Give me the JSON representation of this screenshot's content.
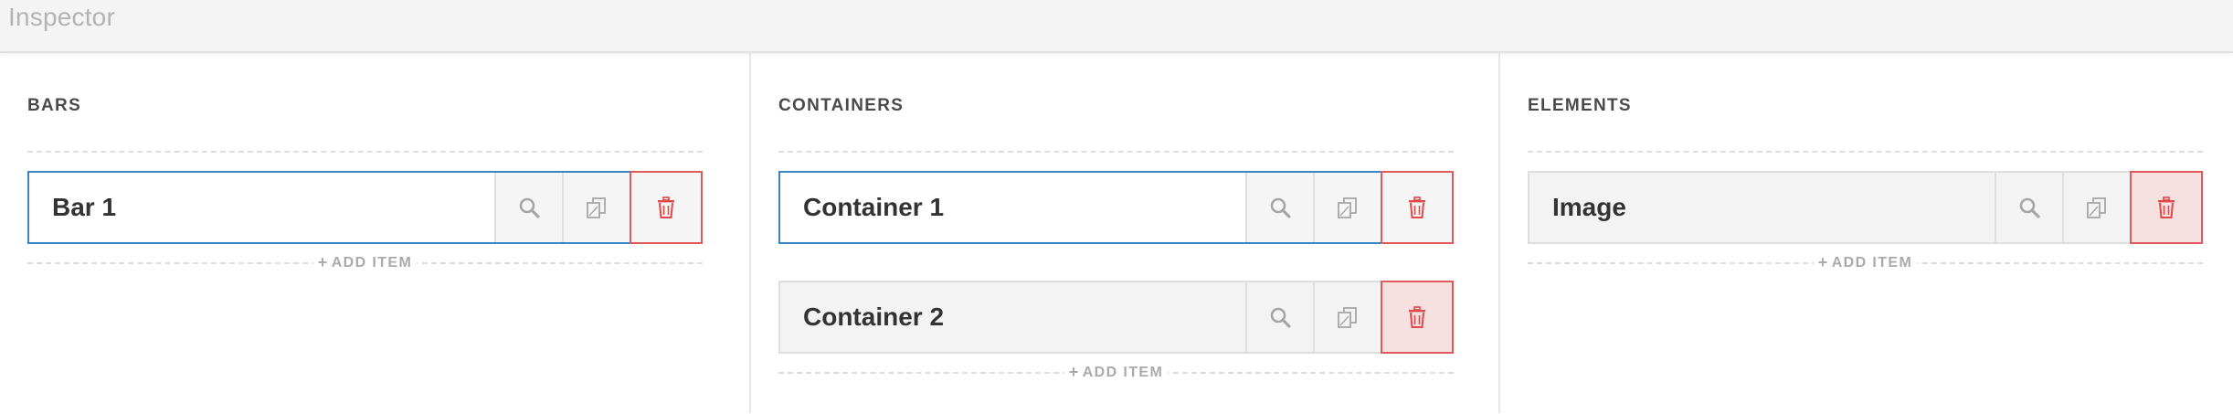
{
  "app": {
    "title": "Inspector"
  },
  "columns": [
    {
      "heading": "BARS",
      "items": [
        {
          "label": "Bar 1",
          "active": true
        }
      ],
      "add_label": "ADD ITEM"
    },
    {
      "heading": "CONTAINERS",
      "items": [
        {
          "label": "Container 1",
          "active": true
        },
        {
          "label": "Container 2",
          "active": false
        }
      ],
      "add_label": "ADD ITEM"
    },
    {
      "heading": "ELEMENTS",
      "items": [
        {
          "label": "Image",
          "active": false
        }
      ],
      "add_label": "ADD ITEM"
    }
  ],
  "item_actions": [
    "search-icon",
    "copy-icon",
    "trash-icon"
  ],
  "colors": {
    "active_border": "#3a86c4",
    "delete_accent": "#e05a5a",
    "delete_bg": "#f7e0e0"
  }
}
